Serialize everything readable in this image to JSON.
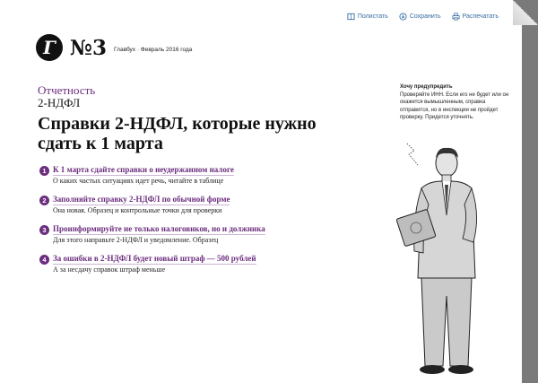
{
  "toolbar": {
    "comment_label": "Полистать",
    "save_label": "Сохранить",
    "print_label": "Распечатать"
  },
  "header": {
    "logo_letter": "Г",
    "issue": "№3",
    "magline": "Главбух · Февраль 2016 года"
  },
  "article": {
    "rubric": "Отчетность",
    "subrubric": "2-НДФЛ",
    "headline": "Справки 2-НДФЛ, которые нужно сдать к 1 марта",
    "items": [
      {
        "num": "1",
        "title": "К 1 марта сдайте справки о неудержанном налоге",
        "desc": "О каких частых ситуациях идет речь, читайте в таблице"
      },
      {
        "num": "2",
        "title": "Заполняйте справку 2-НДФЛ по обычной форме",
        "desc": "Она новая. Образец и контрольные точки для проверки"
      },
      {
        "num": "3",
        "title": "Проинформируйте не только налоговиков, но и должника",
        "desc": "Для этого направьте 2-НДФЛ и уведомление. Образец"
      },
      {
        "num": "4",
        "title": "За ошибки в 2-НДФЛ будет новый штраф — 500 рублей",
        "desc": "А за несдачу справок штраф меньше"
      }
    ]
  },
  "note": {
    "title": "Хочу предупредить",
    "text": "Проверяйте ИНН. Если его не будет или он окажется вымышленным, справка отправится, но в инспекции не пройдет проверку. Придется уточнять."
  },
  "colors": {
    "accent": "#6b2d7d",
    "link": "#3a6ea5"
  }
}
